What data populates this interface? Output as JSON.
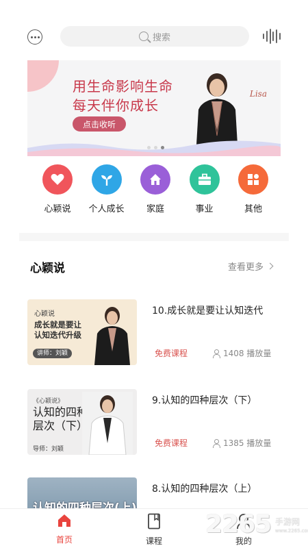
{
  "header": {
    "search_placeholder": "搜索"
  },
  "banner": {
    "slogan_line1": "用生命影响生命",
    "slogan_line2": "每天伴你成长",
    "cta_label": "点击收听",
    "signature": "Lisa"
  },
  "categories": [
    {
      "label": "心颖说",
      "color": "#f0555b",
      "icon": "heart-icon"
    },
    {
      "label": "个人成长",
      "color": "#2fa6e6",
      "icon": "sprout-icon"
    },
    {
      "label": "家庭",
      "color": "#9a5fd8",
      "icon": "house-icon"
    },
    {
      "label": "事业",
      "color": "#2fc39a",
      "icon": "briefcase-icon"
    },
    {
      "label": "其他",
      "color": "#f56a3a",
      "icon": "grid-icon"
    }
  ],
  "section": {
    "title": "心颖说",
    "more_label": "查看更多"
  },
  "courses": [
    {
      "title": "10.成长就是要让认知迭代",
      "price_label": "免费课程",
      "plays": "1408 播放量",
      "thumb_top": "心颖说",
      "thumb_line1": "成长就是要让",
      "thumb_line2": "认知迭代升级",
      "thumb_lecturer": "讲师：刘颖"
    },
    {
      "title": "9.认知的四种层次（下）",
      "price_label": "免费课程",
      "plays": "1385 播放量",
      "thumb_tag": "《心颖说》",
      "thumb_line1": "认知的四种",
      "thumb_line2": "层次（下）",
      "thumb_tutor": "导师：刘颖"
    },
    {
      "title": "8.认知的四种层次（上）",
      "thumb_line1": "认知的四种层次(上)"
    }
  ],
  "nav": {
    "home": "首页",
    "courses": "课程",
    "mine": "我的"
  },
  "watermark": {
    "number": "2265",
    "text": "手游网",
    "url": "www.2265.com"
  },
  "colors": {
    "accent": "#e9443e",
    "banner_pink": "#c8384a"
  }
}
